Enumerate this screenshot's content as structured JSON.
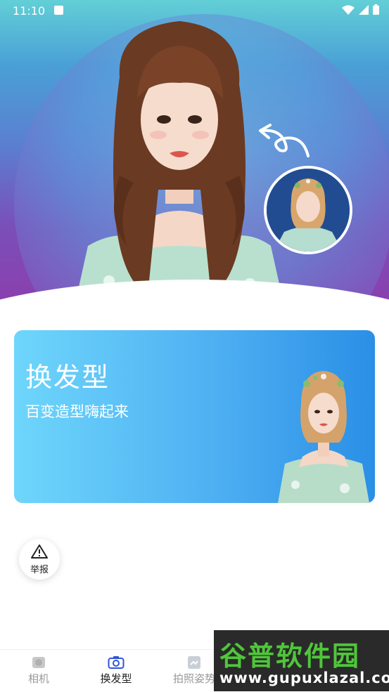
{
  "status_bar": {
    "time": "11:10"
  },
  "card": {
    "title": "换发型",
    "subtitle": "百变造型嗨起来"
  },
  "report": {
    "label": "举报"
  },
  "nav": {
    "items": [
      {
        "label": "相机",
        "active": false
      },
      {
        "label": "换发型",
        "active": true
      },
      {
        "label": "拍照姿势",
        "active": false
      }
    ],
    "active_color": "#222222",
    "inactive_color": "#9a9a9a",
    "accent": "#2f56d6"
  },
  "watermark": {
    "brand": "谷普软件园",
    "url": "www.gupuxlazal.com"
  }
}
